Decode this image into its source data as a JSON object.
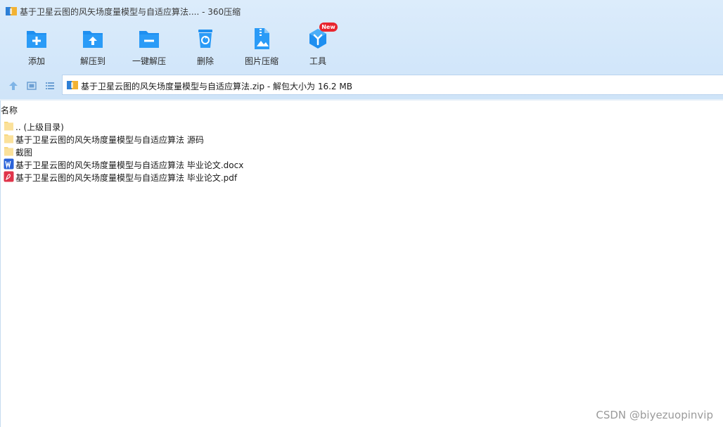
{
  "window": {
    "title": "基于卫星云图的风矢场度量模型与自适应算法.... - 360压缩"
  },
  "toolbar": {
    "buttons": [
      {
        "label": "添加",
        "icon": "add-folder-icon"
      },
      {
        "label": "解压到",
        "icon": "extract-to-icon"
      },
      {
        "label": "一键解压",
        "icon": "one-click-extract-icon"
      },
      {
        "label": "删除",
        "icon": "recycle-bin-icon"
      },
      {
        "label": "图片压缩",
        "icon": "image-compress-icon"
      },
      {
        "label": "工具",
        "icon": "tools-cube-icon"
      }
    ],
    "new_badge": "New"
  },
  "address": {
    "text": "基于卫星云图的风矢场度量模型与自适应算法.zip - 解包大小为 16.2 MB"
  },
  "list": {
    "column_header": "名称",
    "items": [
      {
        "name": ".. (上级目录)",
        "type": "folder"
      },
      {
        "name": "基于卫星云图的风矢场度量模型与自适应算法 源码",
        "type": "folder"
      },
      {
        "name": "截图",
        "type": "folder"
      },
      {
        "name": "基于卫星云图的风矢场度量模型与自适应算法 毕业论文.docx",
        "type": "docx"
      },
      {
        "name": "基于卫星云图的风矢场度量模型与自适应算法 毕业论文.pdf",
        "type": "pdf"
      }
    ]
  },
  "watermark": "CSDN @biyezuopinvip",
  "colors": {
    "accent": "#1e8ff0",
    "badge": "#e8252e",
    "folder": "#f7d982"
  }
}
